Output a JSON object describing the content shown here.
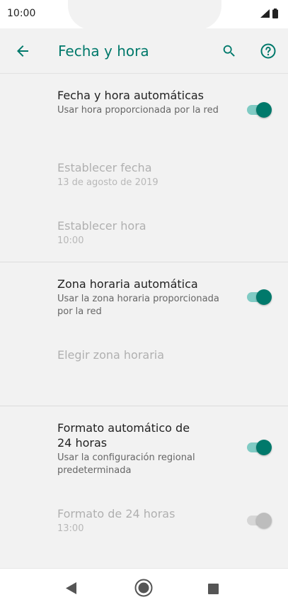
{
  "status_bar": {
    "time": "10:00"
  },
  "app_bar": {
    "title": "Fecha y hora"
  },
  "settings": {
    "auto_datetime": {
      "title": "Fecha y hora automáticas",
      "summary": "Usar hora proporcionada por la red",
      "enabled": true
    },
    "set_date": {
      "title": "Establecer fecha",
      "summary": "13 de agosto de 2019"
    },
    "set_time": {
      "title": "Establecer hora",
      "summary": "10:00"
    },
    "auto_timezone": {
      "title": "Zona horaria automática",
      "summary": "Usar la zona horaria proporcionada por la red",
      "enabled": true
    },
    "choose_timezone": {
      "title": "Elegir zona horaria"
    },
    "auto_24h": {
      "title": "Formato automático de 24 horas",
      "summary": "Usar la configuración regional predeterminada",
      "enabled": true
    },
    "format_24h": {
      "title": "Formato de 24 horas",
      "summary": "13:00",
      "enabled": false
    }
  },
  "colors": {
    "accent": "#00796b",
    "accent_track": "#80cbc4",
    "background": "#f2f2f2"
  },
  "icons": [
    "back-arrow-icon",
    "search-icon",
    "help-icon",
    "signal-icon",
    "battery-icon",
    "nav-back-icon",
    "nav-home-icon",
    "nav-recents-icon"
  ]
}
